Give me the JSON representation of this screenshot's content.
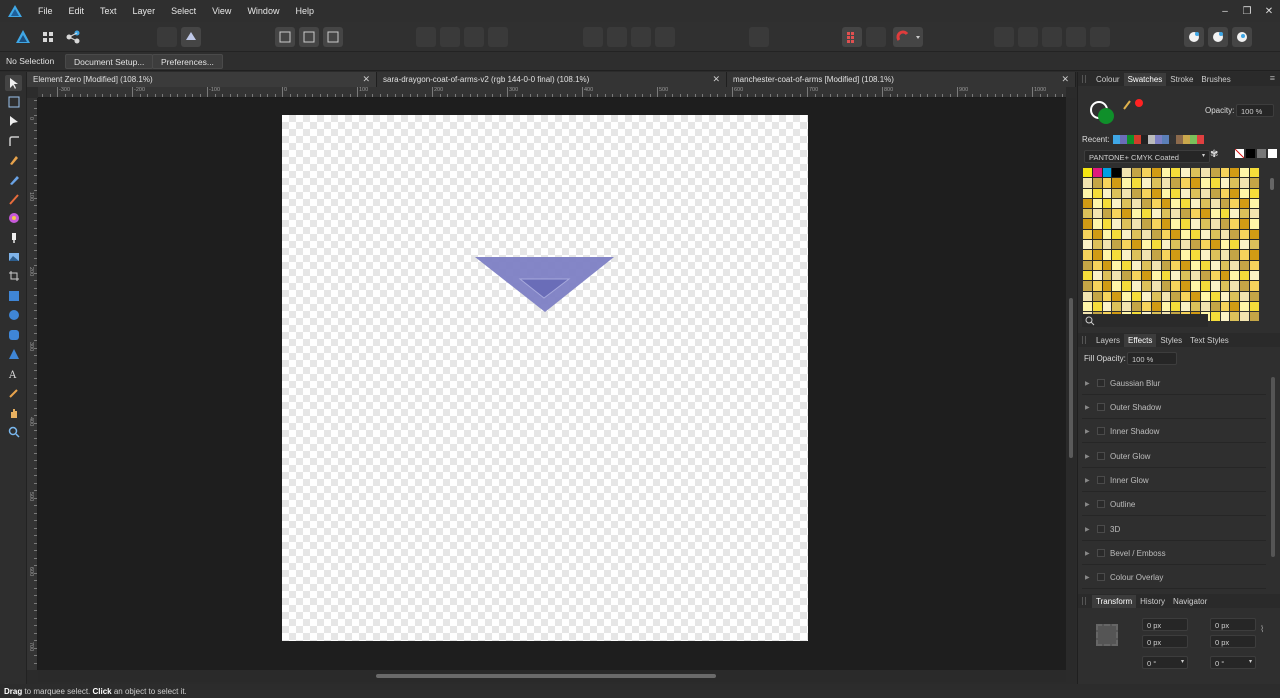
{
  "menu": [
    "File",
    "Edit",
    "Text",
    "Layer",
    "Select",
    "View",
    "Window",
    "Help"
  ],
  "window_controls": [
    "–",
    "❐",
    "✕"
  ],
  "context": {
    "selection": "No Selection",
    "document_setup": "Document Setup...",
    "preferences": "Preferences..."
  },
  "tabs": [
    {
      "label": "Element Zero [Modified] (108.1%)"
    },
    {
      "label": "sara-draygon-coat-of-arms-v2 (rgb 144-0-0 final) (108.1%)"
    },
    {
      "label": "manchester-coat-of-arms [Modified] (108.1%)"
    }
  ],
  "ruler_h": [
    "-300",
    "-200",
    "-100",
    "0",
    "100",
    "200",
    "300",
    "400",
    "500",
    "600",
    "700",
    "800",
    "900",
    "1000"
  ],
  "ruler_v": [
    "0",
    "100",
    "200",
    "300",
    "400",
    "500",
    "600",
    "700"
  ],
  "panel_top": {
    "tabs": [
      "Colour",
      "Swatches",
      "Stroke",
      "Brushes"
    ],
    "active": "Swatches",
    "opacity_label": "Opacity:",
    "opacity_value": "100 %",
    "recent_label": "Recent:",
    "palette_name": "PANTONE+ CMYK Coated",
    "fill_color": "#0f8f2a",
    "stroke_color": "#ff2222"
  },
  "panel_mid": {
    "tabs": [
      "Layers",
      "Effects",
      "Styles",
      "Text Styles"
    ],
    "active": "Effects",
    "fill_opacity_label": "Fill Opacity:",
    "fill_opacity_value": "100 %",
    "effects": [
      "Gaussian Blur",
      "Outer Shadow",
      "Inner Shadow",
      "Outer Glow",
      "Inner Glow",
      "Outline",
      "3D",
      "Bevel / Emboss",
      "Colour Overlay"
    ]
  },
  "panel_bottom": {
    "tabs": [
      "Transform",
      "History",
      "Navigator"
    ],
    "active": "Transform",
    "x": "0 px",
    "y": "0 px",
    "w": "0 px",
    "h": "0 px",
    "r": "0 °",
    "s": "0 °"
  },
  "status": {
    "drag": "Drag",
    "drag_text": " to marquee select. ",
    "click": "Click",
    "click_text": " an object to select it."
  },
  "colors": {
    "triangle_outer": "#7d80c4",
    "triangle_inner": "#6a6db8"
  }
}
